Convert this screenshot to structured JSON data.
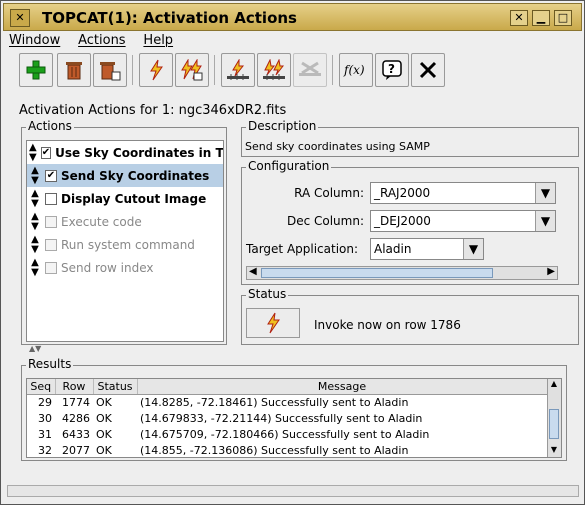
{
  "window": {
    "title": "TOPCAT(1): Activation Actions",
    "controls": [
      "close",
      "minimize",
      "maximize",
      "close"
    ]
  },
  "menu": [
    "Window",
    "Actions",
    "Help"
  ],
  "toolbar": {
    "icons": [
      "add-icon",
      "delete-icon",
      "delete-all-icon",
      "lightning-icon",
      "lightning-multi-icon",
      "invoke-row-icon",
      "invoke-all-icon",
      "disabled-invoke-icon",
      "function-icon",
      "help-icon",
      "close-icon"
    ]
  },
  "heading": "Activation Actions for 1: ngc346xDR2.fits",
  "actions": {
    "title": "Actions",
    "items": [
      {
        "label": "Use Sky Coordinates in TC",
        "checked": true,
        "enabled": true,
        "selected": false
      },
      {
        "label": "Send Sky Coordinates",
        "checked": true,
        "enabled": true,
        "selected": true
      },
      {
        "label": "Display Cutout Image",
        "checked": false,
        "enabled": true,
        "selected": false
      },
      {
        "label": "Execute code",
        "checked": false,
        "enabled": false,
        "selected": false
      },
      {
        "label": "Run system command",
        "checked": false,
        "enabled": false,
        "selected": false
      },
      {
        "label": "Send row index",
        "checked": false,
        "enabled": false,
        "selected": false
      }
    ]
  },
  "description": {
    "title": "Description",
    "text": "Send sky coordinates using SAMP"
  },
  "configuration": {
    "title": "Configuration",
    "ra_label": "RA Column:",
    "ra_value": "_RAJ2000",
    "dec_label": "Dec Column:",
    "dec_value": "_DEJ2000",
    "target_label": "Target Application:",
    "target_value": "Aladin"
  },
  "status": {
    "title": "Status",
    "text": "Invoke now on row 1786"
  },
  "results": {
    "title": "Results",
    "columns": [
      "Seq",
      "Row",
      "Status",
      "Message"
    ],
    "rows": [
      [
        "29",
        "1774",
        "OK",
        "(14.8285, -72.18461) Successfully sent to Aladin"
      ],
      [
        "30",
        "4286",
        "OK",
        "(14.679833, -72.21144) Successfully sent to Aladin"
      ],
      [
        "31",
        "6433",
        "OK",
        "(14.675709, -72.180466) Successfully sent to Aladin"
      ],
      [
        "32",
        "2077",
        "OK",
        "(14.855, -72.136086) Successfully sent to Aladin"
      ]
    ]
  }
}
